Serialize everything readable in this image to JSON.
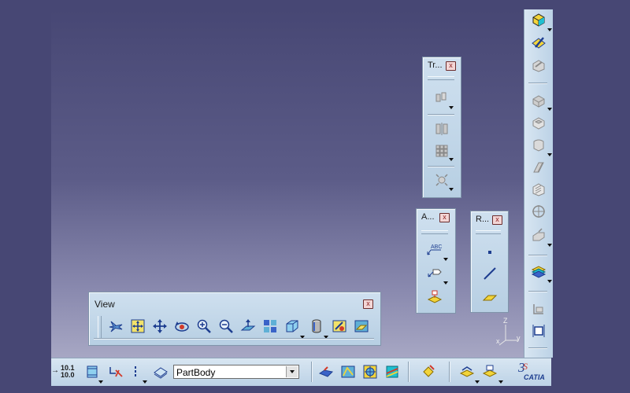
{
  "view_toolbar": {
    "title": "View",
    "close_label": "x",
    "items": [
      "fly-mode-icon",
      "fit-all-icon",
      "pan-icon",
      "rotate-icon",
      "zoom-in-icon",
      "zoom-out-icon",
      "normal-view-icon",
      "multi-view-icon",
      "iso-view-icon",
      "shading-icon",
      "hide-show-icon",
      "swap-space-icon"
    ]
  },
  "tr_toolbar": {
    "title": "Tr...",
    "close_label": "x"
  },
  "a_toolbar": {
    "title": "A...",
    "close_label": "x",
    "text_icon_label": "ABC"
  },
  "r_toolbar": {
    "title": "R...",
    "close_label": "x"
  },
  "bottom_bar": {
    "scale_top": "10.1",
    "scale_bottom": "10.0",
    "part_select": "PartBody"
  },
  "axis_labels": {
    "z": "Z",
    "x": "x",
    "y": "y"
  },
  "brand": {
    "name": "CATIA"
  },
  "colors": {
    "accent_yellow": "#f2d43a",
    "icon_blue": "#3a63c8",
    "icon_red": "#d23a2a"
  }
}
